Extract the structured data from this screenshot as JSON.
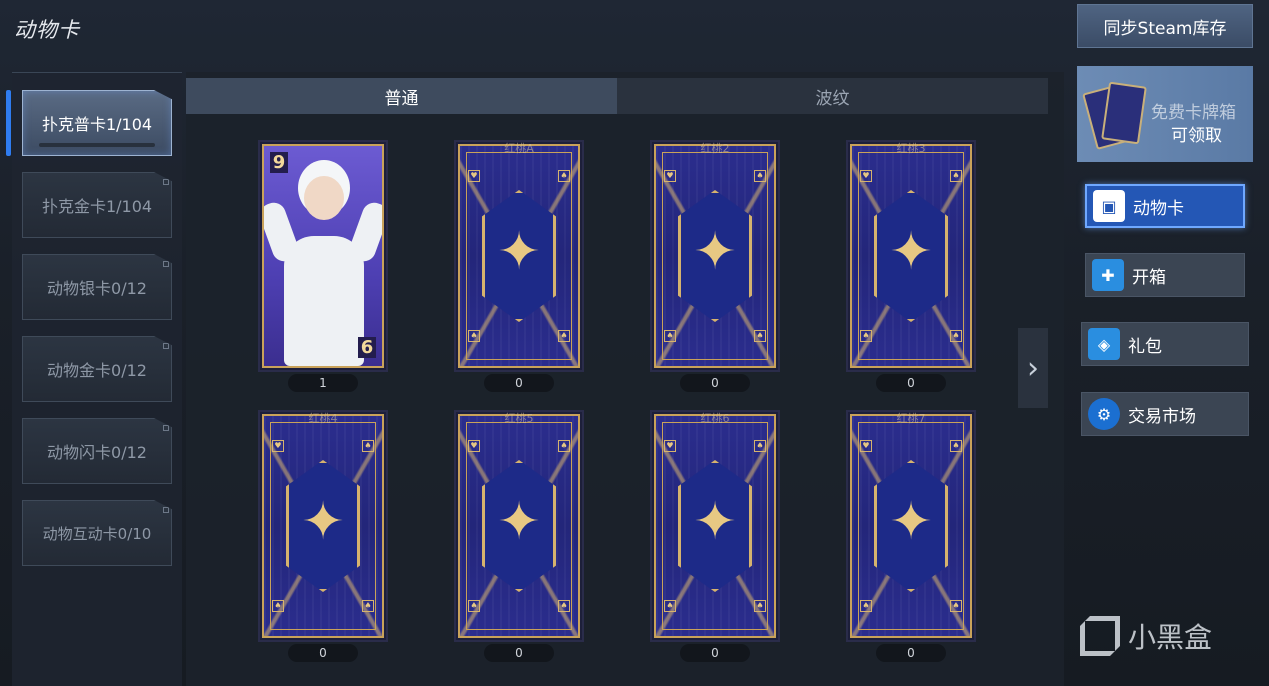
{
  "page": {
    "title": "动物卡"
  },
  "categories": [
    {
      "label": "扑克普卡1/104",
      "active": true
    },
    {
      "label": "扑克金卡1/104",
      "active": false
    },
    {
      "label": "动物银卡0/12",
      "active": false
    },
    {
      "label": "动物金卡0/12",
      "active": false
    },
    {
      "label": "动物闪卡0/12",
      "active": false
    },
    {
      "label": "动物互动卡0/10",
      "active": false
    }
  ],
  "tabs": [
    {
      "label": "普通",
      "active": true
    },
    {
      "label": "波纹",
      "active": false
    }
  ],
  "cards": [
    {
      "name": "",
      "count": "1",
      "rank": "9",
      "rank_bottom": "6",
      "revealed": true
    },
    {
      "name": "红桃A",
      "count": "0"
    },
    {
      "name": "红桃2",
      "count": "0"
    },
    {
      "name": "红桃3",
      "count": "0"
    },
    {
      "name": "红桃4",
      "count": "0"
    },
    {
      "name": "红桃5",
      "count": "0"
    },
    {
      "name": "红桃6",
      "count": "0"
    },
    {
      "name": "红桃7",
      "count": "0"
    }
  ],
  "pager": {
    "next_icon": "chevron-right-icon"
  },
  "side": {
    "sync_label": "同步Steam库存",
    "free_box_label1": "免费卡牌箱",
    "free_box_label2": "可领取",
    "menu": [
      {
        "label": "动物卡",
        "icon": "card-icon",
        "active": true
      },
      {
        "label": "开箱",
        "icon": "gift-icon",
        "active": false
      },
      {
        "label": "礼包",
        "icon": "package-icon",
        "active": false
      },
      {
        "label": "交易市场",
        "icon": "steam-icon",
        "active": false
      }
    ]
  },
  "watermark": {
    "text": "小黑盒"
  },
  "colors": {
    "accent": "#2f7cf0",
    "gold": "#c9a25a",
    "card_blue": "#2b2d8e"
  }
}
